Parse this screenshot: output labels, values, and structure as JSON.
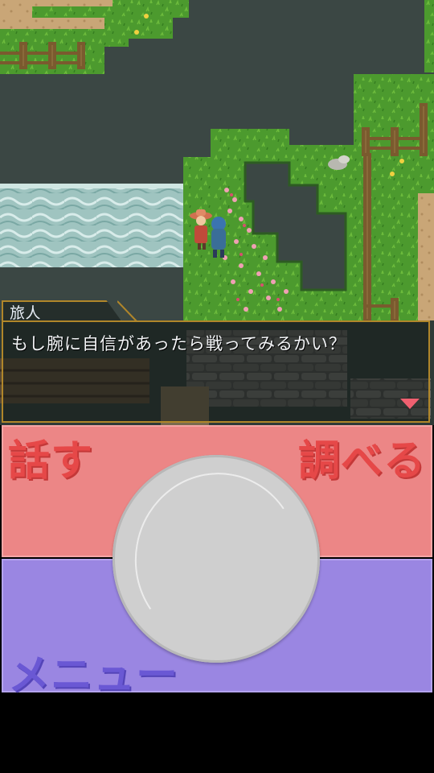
{
  "dialog": {
    "speaker": "旅人",
    "message": "もし腕に自信があったら戦ってみるかい？"
  },
  "controls": {
    "talk_label": "話す",
    "examine_label": "調べる",
    "menu_label": "メニュー"
  },
  "colors": {
    "water": "#3b4744",
    "grass": "#4c9a2e",
    "dialog_border": "#b0862a",
    "talk_panel": "#ec8686",
    "menu_panel": "#9a86e2",
    "talk_text": "#e64848",
    "menu_text": "#6a58d4",
    "next_arrow": "#f06070"
  }
}
